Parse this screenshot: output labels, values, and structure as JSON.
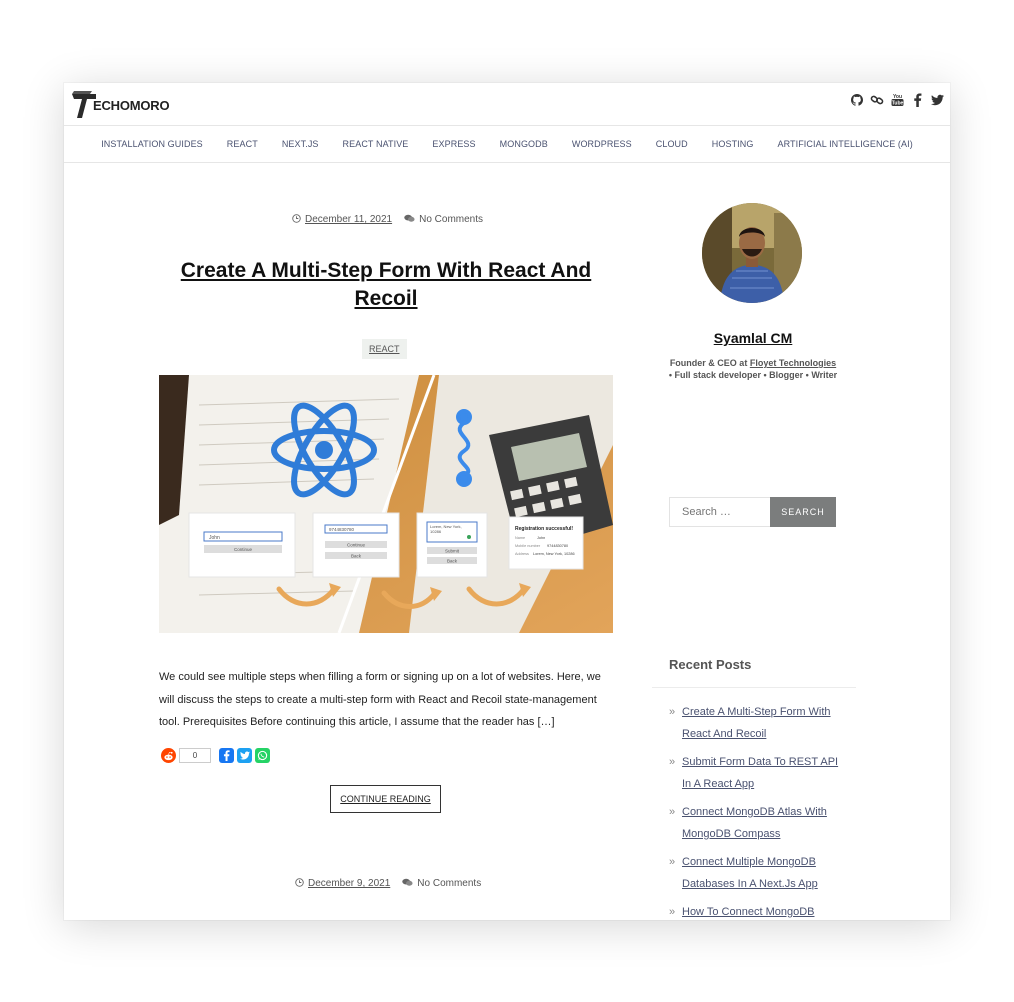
{
  "header": {
    "logo_text": "ECHOMORO",
    "logo_letter": "T",
    "socials": [
      "github-icon",
      "link-icon",
      "youtube-icon",
      "facebook-icon",
      "twitter-icon"
    ],
    "youtube_label": "You Tube"
  },
  "nav": {
    "items": [
      {
        "label": "INSTALLATION GUIDES"
      },
      {
        "label": "REACT"
      },
      {
        "label": "NEXT.JS"
      },
      {
        "label": "REACT NATIVE"
      },
      {
        "label": "EXPRESS"
      },
      {
        "label": "MONGODB"
      },
      {
        "label": "WORDPRESS"
      },
      {
        "label": "CLOUD"
      },
      {
        "label": "HOSTING"
      },
      {
        "label": "ARTIFICIAL INTELLIGENCE (AI)"
      }
    ]
  },
  "post": {
    "date": "December 11, 2021",
    "comments": "No Comments",
    "title": "Create A Multi-Step Form With React And Recoil",
    "category": "REACT",
    "hero": {
      "card1_field": "John",
      "card1_button": "Continue",
      "card2_field": "9744830780",
      "card2_button1": "Continue",
      "card2_button2": "Back",
      "card3_line1": "Lorem, New York,",
      "card3_line2": "10286",
      "card3_button": "Submit",
      "card3_button2": "Back",
      "card4_title": "Registration successful!",
      "card4_row1_label": "Name",
      "card4_row1_value": "John",
      "card4_row2_label": "Mobile number",
      "card4_row2_value": "9744830780",
      "card4_row3_label": "Address",
      "card4_row3_value": "Lorem, New York, 10286"
    },
    "excerpt": "We could see multiple steps when filling a form or signing up on a lot of websites. Here, we will discuss the steps to create a multi-step form with React and Recoil state-management tool. Prerequisites Before continuing this article, I assume that the reader has […]",
    "share_count": "0",
    "continue_label": "CONTINUE READING"
  },
  "next_post": {
    "date": "December 9, 2021",
    "comments": "No Comments"
  },
  "sidebar": {
    "author_name": "Syamlal CM",
    "bio_prefix": "Founder & CEO at ",
    "bio_company": "Floyet Technologies",
    "bio_rest": "• Full stack developer • Blogger • Writer",
    "search_placeholder": "Search …",
    "search_button": "SEARCH",
    "recent_title": "Recent Posts",
    "recent_posts": [
      {
        "title": "Create A Multi-Step Form With React And Recoil"
      },
      {
        "title": "Submit Form Data To REST API In A React App"
      },
      {
        "title": "Connect MongoDB Atlas With MongoDB Compass"
      },
      {
        "title": "Connect Multiple MongoDB Databases In A Next.Js App"
      },
      {
        "title": "How To Connect MongoDB"
      }
    ]
  },
  "colors": {
    "react_blue": "#2f7cd8",
    "reddit": "#ff4500",
    "facebook": "#1877f2",
    "twitter": "#1da1f2",
    "whatsapp": "#25d366",
    "nav_text": "#4a5270"
  }
}
